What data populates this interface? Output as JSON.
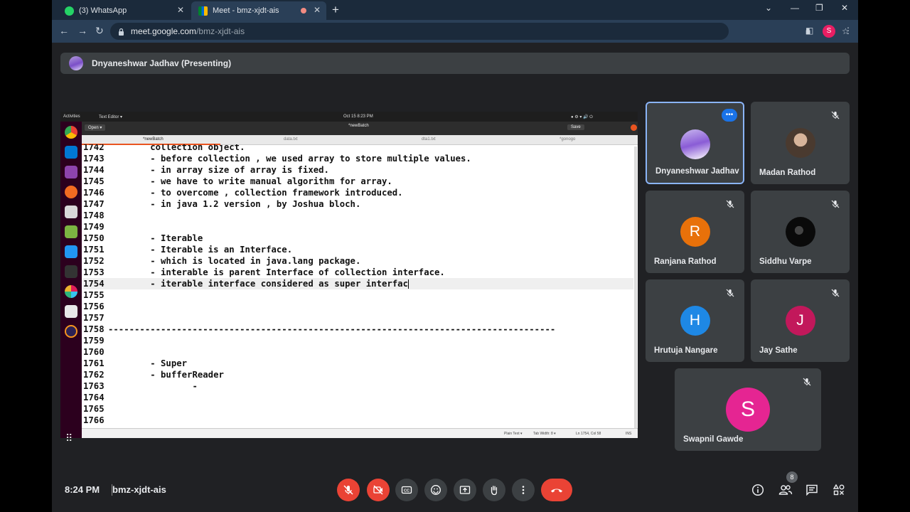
{
  "browser": {
    "tabs": [
      {
        "title": "(3) WhatsApp",
        "icon": "whatsapp-icon"
      },
      {
        "title": "Meet - bmz-xjdt-ais",
        "icon": "google-meet-icon"
      }
    ],
    "url_host": "meet.google.com",
    "url_path": "/bmz-xjdt-ais",
    "profile_initial": "S"
  },
  "presenter": {
    "label": "Dnyaneshwar Jadhav (Presenting)"
  },
  "shared_screen": {
    "topbar": {
      "activities": "Activities",
      "app": "Text Editor ▾",
      "clock": "Oct 15  8:23 PM"
    },
    "editor": {
      "open_label": "Open ▾",
      "title": "*newBatch",
      "save_label": "Save",
      "tabs": [
        "*newBatch",
        "data.txt",
        "dta1.txt",
        "*gonogo"
      ],
      "lines": [
        {
          "n": "1742",
          "t": "        collection object."
        },
        {
          "n": "1743",
          "t": "        - before collection , we used array to store multiple values."
        },
        {
          "n": "1744",
          "t": "        - in array size of array is fixed."
        },
        {
          "n": "1745",
          "t": "        - we have to write manual algorithm for array."
        },
        {
          "n": "1746",
          "t": "        - to overcome , collection framework introduced."
        },
        {
          "n": "1747",
          "t": "        - in java 1.2 version , by Joshua bloch."
        },
        {
          "n": "1748",
          "t": ""
        },
        {
          "n": "1749",
          "t": ""
        },
        {
          "n": "1750",
          "t": "        - Iterable"
        },
        {
          "n": "1751",
          "t": "        - Iterable is an Interface."
        },
        {
          "n": "1752",
          "t": "        - which is located in java.lang package."
        },
        {
          "n": "1753",
          "t": "        - interable is parent Interface of collection interface."
        },
        {
          "n": "1754",
          "t": "        - iterable interface considered as super interfac"
        },
        {
          "n": "1755",
          "t": ""
        },
        {
          "n": "1756",
          "t": ""
        },
        {
          "n": "1757",
          "t": ""
        },
        {
          "n": "1758",
          "t": "-------------------------------------------------------------------------------------"
        },
        {
          "n": "1759",
          "t": ""
        },
        {
          "n": "1760",
          "t": ""
        },
        {
          "n": "1761",
          "t": "        - Super"
        },
        {
          "n": "1762",
          "t": "        - bufferReader"
        },
        {
          "n": "1763",
          "t": "                -"
        },
        {
          "n": "1764",
          "t": ""
        },
        {
          "n": "1765",
          "t": ""
        },
        {
          "n": "1766",
          "t": ""
        }
      ],
      "status": {
        "mode": "Plain Text ▾",
        "tab_width": "Tab Width: 8 ▾",
        "position": "Ln 1754, Col 58",
        "ins": "INS"
      }
    }
  },
  "participants": [
    {
      "name": "Dnyaneshwar Jadhav",
      "avatar": "photo",
      "color": "#7b4fc8",
      "initial": "",
      "active": true
    },
    {
      "name": "Madan Rathod",
      "avatar": "photo",
      "color": "#6d5a4a",
      "initial": "",
      "active": false
    },
    {
      "name": "Ranjana Rathod",
      "avatar": "letter",
      "color": "#e8710a",
      "initial": "R",
      "active": false
    },
    {
      "name": "Siddhu Varpe",
      "avatar": "photo",
      "color": "#111111",
      "initial": "",
      "active": false
    },
    {
      "name": "Hrutuja Nangare",
      "avatar": "letter",
      "color": "#1e88e5",
      "initial": "H",
      "active": false
    },
    {
      "name": "Jay Sathe",
      "avatar": "letter",
      "color": "#c2185b",
      "initial": "J",
      "active": false
    },
    {
      "name": "Swapnil Gawde",
      "avatar": "letter",
      "color": "#e52592",
      "initial": "S",
      "active": false
    }
  ],
  "bottom_bar": {
    "time": "8:24 PM",
    "meeting_code": "bmz-xjdt-ais",
    "participants_count": "8"
  }
}
